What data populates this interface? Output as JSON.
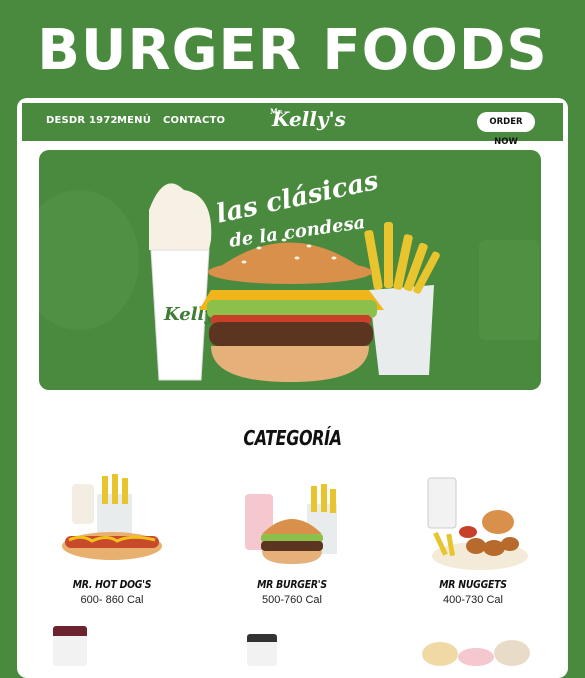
{
  "headline": "BURGER FOODS",
  "nav": {
    "links": [
      "DESDR 1972",
      "MENÚ",
      "CONTACTO"
    ],
    "logo_small": "Mr.",
    "logo": "Kelly's",
    "order_button": "ORDER NOW"
  },
  "hero": {
    "script_line1": "las clásicas",
    "script_line2": "de la condesa",
    "cup_brand": "Kelly's"
  },
  "section_title": "CATEGORÍA",
  "categories": [
    {
      "name": "MR. HOT DOG'S",
      "calories": "600- 860 Cal"
    },
    {
      "name": "MR BURGER'S",
      "calories": "500-760 Cal"
    },
    {
      "name": "MR NUGGETS",
      "calories": "400-730 Cal"
    }
  ],
  "colors": {
    "brand_green": "#4a8a3f",
    "white": "#ffffff"
  }
}
